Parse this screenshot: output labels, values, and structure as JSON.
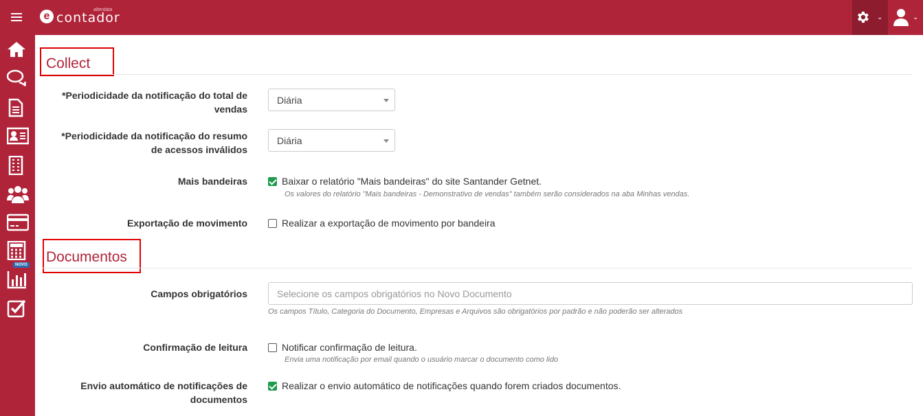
{
  "app": {
    "logo_text": "contador",
    "logo_small": "alterdata",
    "logo_letter": "e"
  },
  "header": {
    "settings_icon": "gear-icon",
    "user_icon": "user-icon",
    "caret": "⌄"
  },
  "sidebar": {
    "items": [
      {
        "icon": "home-icon"
      },
      {
        "icon": "chat-icon"
      },
      {
        "icon": "document-icon"
      },
      {
        "icon": "contact-card-icon"
      },
      {
        "icon": "building-icon"
      },
      {
        "icon": "users-icon"
      },
      {
        "icon": "credit-card-icon"
      },
      {
        "icon": "calculator-icon"
      },
      {
        "icon": "bar-chart-icon"
      },
      {
        "icon": "checklist-icon"
      }
    ],
    "novo_badge": "NOVO"
  },
  "collect": {
    "title": "Collect",
    "periodicidade_total": {
      "label_line1": "*Periodicidade da notificação do total de",
      "label_line2": "vendas",
      "value": "Diária"
    },
    "periodicidade_resumo": {
      "label_line1": "*Periodicidade da notificação do resumo",
      "label_line2": "de acessos inválidos",
      "value": "Diária"
    },
    "mais_bandeiras": {
      "label": "Mais bandeiras",
      "checkbox_label": "Baixar o relatório \"Mais bandeiras\" do site Santander Getnet.",
      "checked": true,
      "help": "Os valores do relatório \"Mais bandeiras - Demonstrativo de vendas\" também serão considerados na aba Minhas vendas."
    },
    "exportacao": {
      "label": "Exportação de movimento",
      "checkbox_label": "Realizar a exportação de movimento por bandeira",
      "checked": false
    }
  },
  "documentos": {
    "title": "Documentos",
    "campos": {
      "label": "Campos obrigatórios",
      "placeholder": "Selecione os campos obrigatórios no Novo Documento",
      "help": "Os campos Título, Categoria do Documento, Empresas e Arquivos são obrigatórios por padrão e não poderão ser alterados"
    },
    "confirmacao": {
      "label": "Confirmação de leitura",
      "checkbox_label": "Notificar confirmação de leitura.",
      "checked": false,
      "help": "Envia uma notificação por email quando o usuário marcar o documento como lido"
    },
    "envio": {
      "label_line1": "Envio automático de notificações de",
      "label_line2": "documentos",
      "checkbox_label": "Realizar o envio automático de notificações quando forem criados documentos.",
      "checked": true
    }
  }
}
